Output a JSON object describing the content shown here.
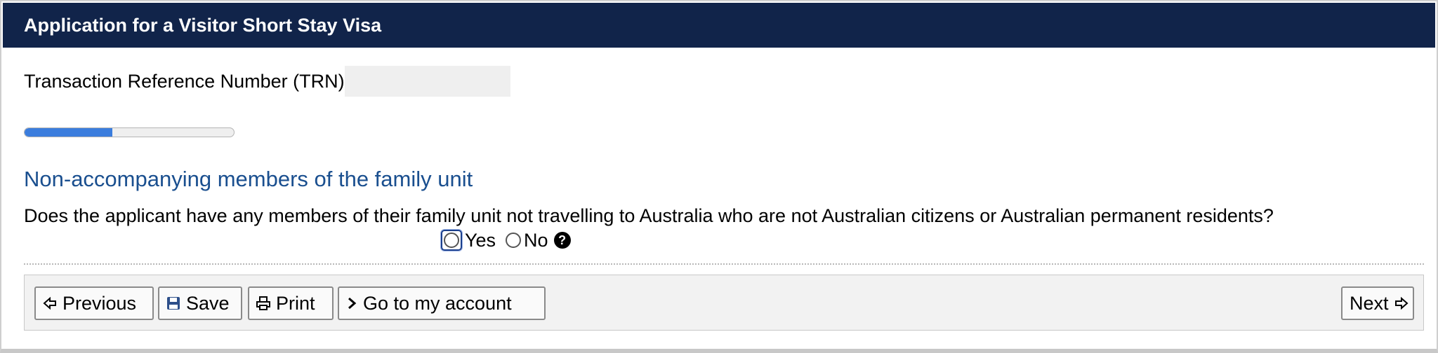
{
  "header": {
    "title": "Application for a Visitor Short Stay Visa"
  },
  "trn": {
    "label": "Transaction Reference Number (TRN)",
    "value": ""
  },
  "progress": {
    "fraction": 0.42
  },
  "section": {
    "title": "Non-accompanying members of the family unit"
  },
  "question": {
    "text": "Does the applicant have any members of their family unit not travelling to Australia who are not Australian citizens or Australian permanent residents?",
    "options": [
      {
        "label": "Yes"
      },
      {
        "label": "No"
      }
    ],
    "help_icon": "question-circle-icon"
  },
  "toolbar": {
    "previous_label": "Previous",
    "save_label": "Save",
    "print_label": "Print",
    "account_label": "Go to my account",
    "next_label": "Next"
  },
  "colors": {
    "header_bg": "#11244a",
    "section_title": "#1a4f8f",
    "progress_fill": "#3b7ddd"
  }
}
